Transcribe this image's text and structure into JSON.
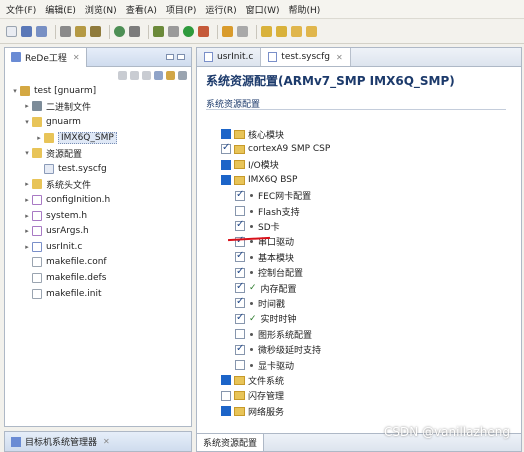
{
  "menubar": [
    "文件(F)",
    "编辑(E)",
    "浏览(N)",
    "查看(A)",
    "项目(P)",
    "运行(R)",
    "窗口(W)",
    "帮助(H)"
  ],
  "left_panel": {
    "tab_title": "ReDe工程",
    "tree": [
      {
        "label": "test [gnuarm]",
        "depth": 0,
        "twisty": "▾",
        "icon": "project-icon"
      },
      {
        "label": "二进制文件",
        "depth": 1,
        "twisty": "▸",
        "icon": "binary-icon"
      },
      {
        "label": "gnuarm",
        "depth": 1,
        "twisty": "▾",
        "icon": "folder-icon"
      },
      {
        "label": "IMX6Q_SMP",
        "depth": 2,
        "twisty": "▸",
        "icon": "folder-icon",
        "selected": true
      },
      {
        "label": "资源配置",
        "depth": 1,
        "twisty": "▾",
        "icon": "folder-icon"
      },
      {
        "label": "test.syscfg",
        "depth": 2,
        "twisty": "",
        "icon": "config-file-icon"
      },
      {
        "label": "系统头文件",
        "depth": 1,
        "twisty": "▸",
        "icon": "folder-icon"
      },
      {
        "label": "configInition.h",
        "depth": 1,
        "twisty": "▸",
        "icon": "header-file-icon"
      },
      {
        "label": "system.h",
        "depth": 1,
        "twisty": "▸",
        "icon": "header-file-icon"
      },
      {
        "label": "usrArgs.h",
        "depth": 1,
        "twisty": "▸",
        "icon": "header-file-icon"
      },
      {
        "label": "usrInit.c",
        "depth": 1,
        "twisty": "▸",
        "icon": "c-file-icon"
      },
      {
        "label": "makefile.conf",
        "depth": 1,
        "twisty": "",
        "icon": "file-icon"
      },
      {
        "label": "makefile.defs",
        "depth": 1,
        "twisty": "",
        "icon": "file-icon"
      },
      {
        "label": "makefile.init",
        "depth": 1,
        "twisty": "",
        "icon": "file-icon"
      }
    ]
  },
  "bottom_left": {
    "tab_title": "目标机系统管理器"
  },
  "editor": {
    "tabs": [
      {
        "label": "usrInit.c",
        "active": false
      },
      {
        "label": "test.syscfg",
        "active": true
      }
    ],
    "title": "系统资源配置(ARMv7_SMP IMX6Q_SMP)",
    "section": "系统资源配置",
    "config_tree": [
      {
        "label": "核心模块",
        "indent": 0,
        "state": "partial",
        "folder": true,
        "marker": ""
      },
      {
        "label": "cortexA9 SMP CSP",
        "indent": 0,
        "state": "checked",
        "folder": true,
        "marker": ""
      },
      {
        "label": "I/O模块",
        "indent": 0,
        "state": "partial",
        "folder": true,
        "marker": ""
      },
      {
        "label": "IMX6Q BSP",
        "indent": 0,
        "state": "partial",
        "folder": true,
        "marker": ""
      },
      {
        "label": "FEC网卡配置",
        "indent": 1,
        "state": "checked",
        "folder": false,
        "marker": "dot"
      },
      {
        "label": "Flash支持",
        "indent": 1,
        "state": "unchecked",
        "folder": false,
        "marker": "dot"
      },
      {
        "label": "SD卡",
        "indent": 1,
        "state": "checked",
        "folder": false,
        "marker": "dot"
      },
      {
        "label": "串口驱动",
        "indent": 1,
        "state": "checked",
        "folder": false,
        "marker": "dot"
      },
      {
        "label": "基本模块",
        "indent": 1,
        "state": "checked",
        "folder": false,
        "marker": "dot"
      },
      {
        "label": "控制台配置",
        "indent": 1,
        "state": "checked",
        "folder": false,
        "marker": "dot"
      },
      {
        "label": "内存配置",
        "indent": 1,
        "state": "checked",
        "folder": false,
        "marker": "check"
      },
      {
        "label": "时间戳",
        "indent": 1,
        "state": "checked",
        "folder": false,
        "marker": "dot"
      },
      {
        "label": "实时时钟",
        "indent": 1,
        "state": "checked",
        "folder": false,
        "marker": "check"
      },
      {
        "label": "图形系统配置",
        "indent": 1,
        "state": "unchecked",
        "folder": false,
        "marker": "dot"
      },
      {
        "label": "微秒级延时支持",
        "indent": 1,
        "state": "checked",
        "folder": false,
        "marker": "dot"
      },
      {
        "label": "显卡驱动",
        "indent": 1,
        "state": "unchecked",
        "folder": false,
        "marker": "dot"
      },
      {
        "label": "文件系统",
        "indent": 0,
        "state": "partial",
        "folder": true,
        "marker": ""
      },
      {
        "label": "闪存管理",
        "indent": 0,
        "state": "unchecked",
        "folder": true,
        "marker": ""
      },
      {
        "label": "网络服务",
        "indent": 0,
        "state": "partial",
        "folder": true,
        "marker": ""
      }
    ],
    "bottom_tab": "系统资源配置"
  },
  "watermark": "CSDN @vanillazheng"
}
